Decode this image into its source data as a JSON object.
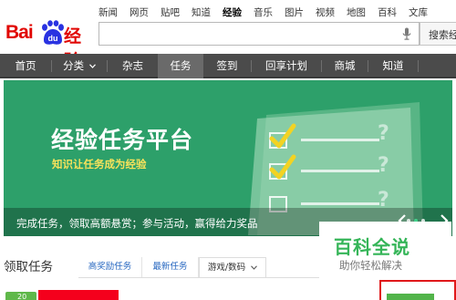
{
  "logo": {
    "part1": "Bai",
    "paw_text": "du",
    "part2": "经验"
  },
  "topnav": {
    "items": [
      "新闻",
      "网页",
      "贴吧",
      "知道",
      "经验",
      "音乐",
      "图片",
      "视频",
      "地图",
      "百科",
      "文库"
    ],
    "active_index": 4
  },
  "search": {
    "value": "",
    "button_label": "搜索经验"
  },
  "mainnav": {
    "items": [
      "首页",
      "分类",
      "杂志",
      "任务",
      "签到",
      "回享计划",
      "商城",
      "知道"
    ],
    "dropdown_icon": "chevron-down-icon",
    "active_index": 3
  },
  "banner": {
    "title": "经验任务平台",
    "subtitle": "知识让任务成为经验",
    "caption": "完成任务，领取高额悬赏；参与活动，赢得给力奖品",
    "checklist": [
      "checked",
      "checked",
      "unchecked"
    ],
    "marks": [
      "?",
      "?",
      "?"
    ],
    "slides_total": 3,
    "slides_current": 1
  },
  "watermark": {
    "title": "百科全说",
    "tagline": "助你轻松解决"
  },
  "tasks": {
    "heading": "领取任务",
    "tabs": [
      "高奖励任务",
      "最新任务",
      "游戏/数码"
    ],
    "current_tab_index": 2,
    "badge_value": "20"
  },
  "colors": {
    "brand_red": "#e10602",
    "brand_blue": "#2932e1",
    "nav_bg": "#4b4b4b",
    "banner_green": "#2da06a",
    "accent_yellow": "#f7e25b",
    "check_yellow": "#f2d323",
    "watermark_green": "#35b558",
    "highlight_red": "#e0181a"
  }
}
